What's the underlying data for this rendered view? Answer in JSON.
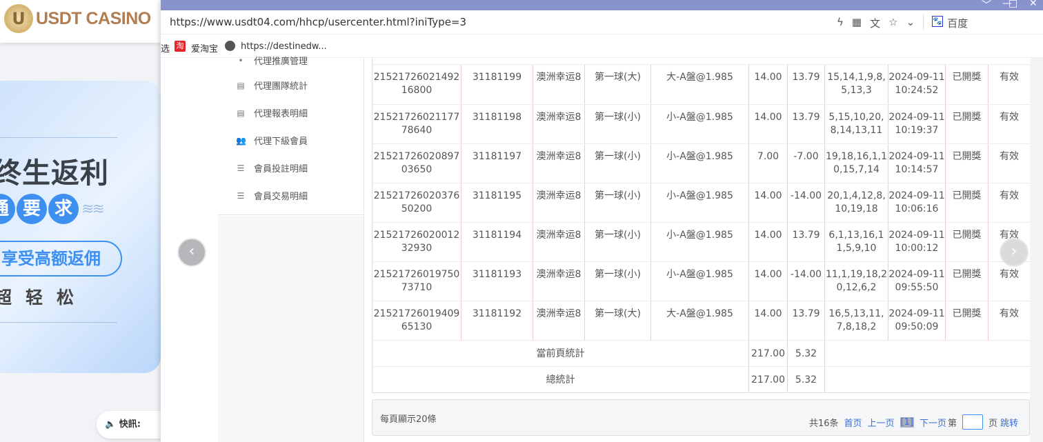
{
  "background": {
    "logo": "USDT CASINO",
    "banner": {
      "title": "终生返利",
      "circles": [
        "通",
        "要",
        "求"
      ],
      "pill": "享受高额返佣",
      "sub": "超轻松"
    },
    "news_label": "快訊:"
  },
  "browser": {
    "url": "https://www.usdt04.com/hhcp/usercenter.html?iniType=3",
    "search_engine": "百度",
    "bookmarks": [
      {
        "label": "选"
      },
      {
        "label": "爱淘宝"
      },
      {
        "label": "https://destinedw..."
      }
    ]
  },
  "menu": {
    "items": [
      {
        "label": "代理推廣管理",
        "icon": "dot-icon"
      },
      {
        "label": "代理團隊統計",
        "icon": "report-icon"
      },
      {
        "label": "代理報表明細",
        "icon": "report-icon"
      },
      {
        "label": "代理下級會員",
        "icon": "users-icon"
      },
      {
        "label": "會員投註明細",
        "icon": "list-icon"
      },
      {
        "label": "會員交易明細",
        "icon": "list-icon"
      }
    ]
  },
  "table": {
    "rows": [
      [
        "2152172602149216800",
        "31181199",
        "澳洲幸运8",
        "第一球(大)",
        "大-A盤@1.985",
        "14.00",
        "13.79",
        "15,14,1,9,8,5,13,3",
        "2024-09-11 10:24:52",
        "已開獎",
        "有效"
      ],
      [
        "2152172602117778640",
        "31181198",
        "澳洲幸运8",
        "第一球(小)",
        "小-A盤@1.985",
        "14.00",
        "13.79",
        "5,15,10,20,8,14,13,11",
        "2024-09-11 10:19:37",
        "已開獎",
        "有效"
      ],
      [
        "2152172602089703650",
        "31181197",
        "澳洲幸运8",
        "第一球(小)",
        "小-A盤@1.985",
        "7.00",
        "-7.00",
        "19,18,16,1,10,15,7,14",
        "2024-09-11 10:14:57",
        "已開獎",
        "有效"
      ],
      [
        "2152172602037650200",
        "31181195",
        "澳洲幸运8",
        "第一球(小)",
        "小-A盤@1.985",
        "14.00",
        "-14.00",
        "20,1,4,12,8,10,19,18",
        "2024-09-11 10:06:16",
        "已開獎",
        "有效"
      ],
      [
        "2152172602001232930",
        "31181194",
        "澳洲幸运8",
        "第一球(小)",
        "小-A盤@1.985",
        "14.00",
        "13.79",
        "6,1,13,16,11,5,9,10",
        "2024-09-11 10:00:12",
        "已開獎",
        "有效"
      ],
      [
        "2152172601975073710",
        "31181193",
        "澳洲幸运8",
        "第一球(小)",
        "小-A盤@1.985",
        "14.00",
        "-14.00",
        "11,1,19,18,20,12,6,2",
        "2024-09-11 09:55:50",
        "已開獎",
        "有效"
      ],
      [
        "2152172601940965130",
        "31181192",
        "澳洲幸运8",
        "第一球(大)",
        "大-A盤@1.985",
        "14.00",
        "13.79",
        "16,5,13,11,7,8,18,2",
        "2024-09-11 09:50:09",
        "已開獎",
        "有效"
      ]
    ],
    "page_total": {
      "label": "當前頁統計",
      "amount": "217.00",
      "result": "5.32"
    },
    "grand_total": {
      "label": "總統計",
      "amount": "217.00",
      "result": "5.32"
    }
  },
  "pager": {
    "per_page": "每頁顯示20條",
    "total": "共16条",
    "first": "首页",
    "prev": "上一页",
    "current": "[1]",
    "next": "下一页",
    "page_prefix": "第",
    "page_suffix": "页",
    "go": "跳转",
    "page_input": ""
  }
}
